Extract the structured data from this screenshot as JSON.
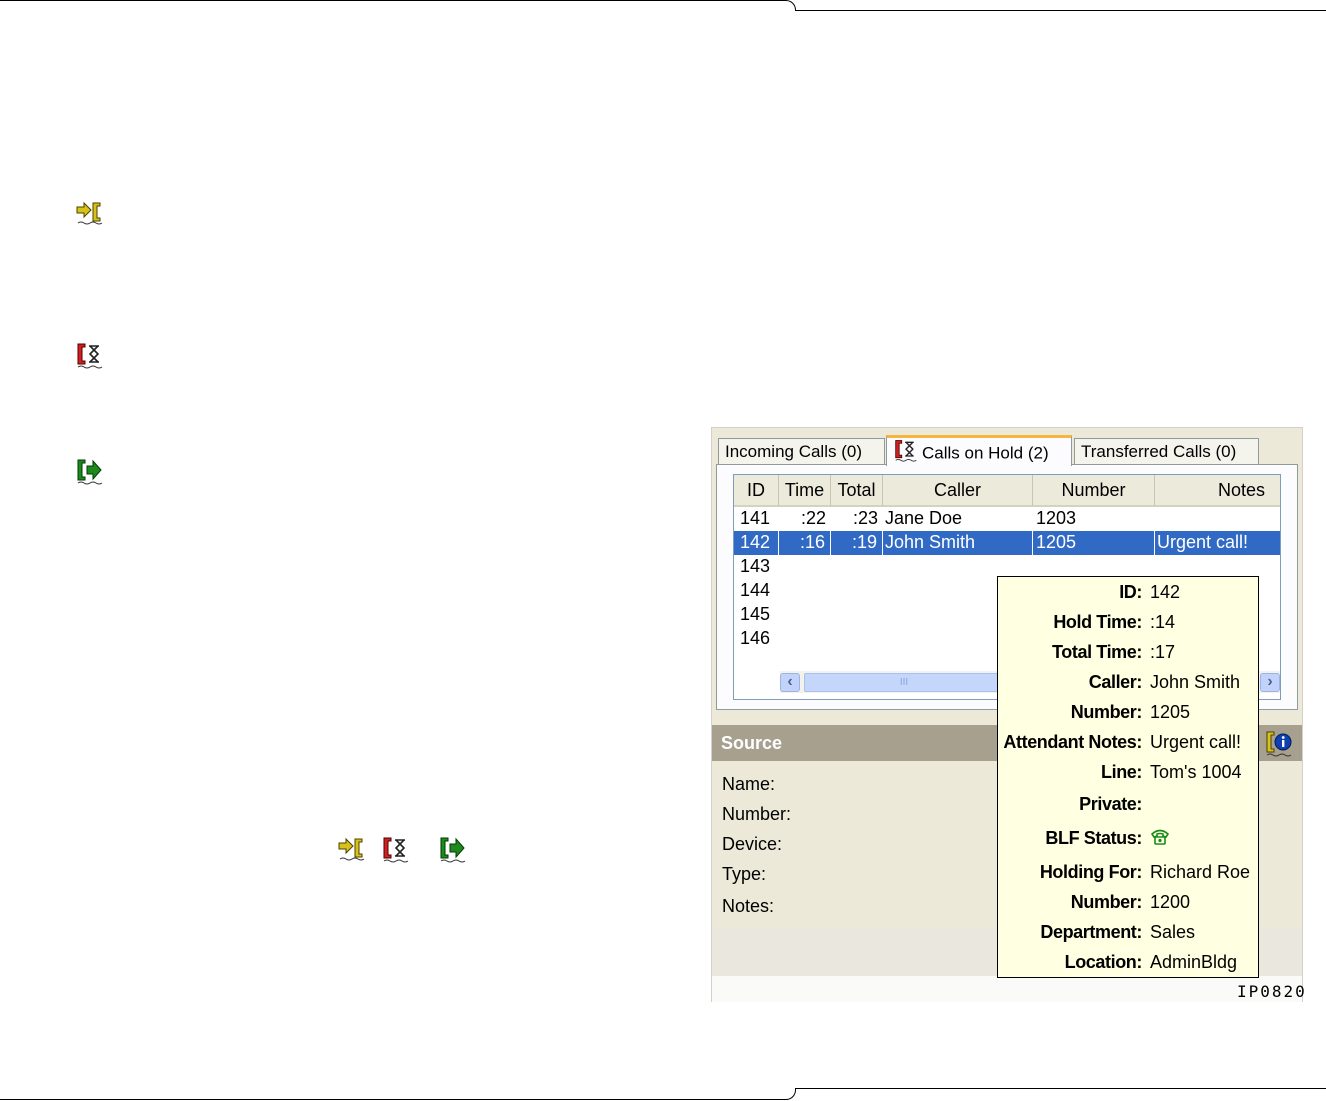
{
  "colors": {
    "selection": "#316ac5",
    "tooltip_bg": "#ffffe1",
    "source_header_bg": "#a7a08f",
    "active_tab_accent": "#f6b53f"
  },
  "legend_icons": [
    "incoming-call-icon",
    "call-on-hold-icon",
    "transferred-call-icon"
  ],
  "tabs": [
    {
      "label": "Incoming Calls (0)",
      "icon": null
    },
    {
      "label": "Calls on Hold (2)",
      "icon": "call-on-hold-icon",
      "active": true
    },
    {
      "label": "Transferred Calls (0)",
      "icon": null
    }
  ],
  "grid": {
    "columns": [
      "ID",
      "Time",
      "Total",
      "Caller",
      "Number",
      "Notes"
    ],
    "rows": [
      {
        "id": "141",
        "time": ":22",
        "total": ":23",
        "caller": "Jane Doe",
        "number": "1203",
        "notes": ""
      },
      {
        "id": "142",
        "time": ":16",
        "total": ":19",
        "caller": "John Smith",
        "number": "1205",
        "notes": "Urgent call!",
        "selected": true
      },
      {
        "id": "143",
        "time": "",
        "total": "",
        "caller": "",
        "number": "",
        "notes": ""
      },
      {
        "id": "144",
        "time": "",
        "total": "",
        "caller": "",
        "number": "",
        "notes": ""
      },
      {
        "id": "145",
        "time": "",
        "total": "",
        "caller": "",
        "number": "",
        "notes": ""
      },
      {
        "id": "146",
        "time": "",
        "total": "",
        "caller": "",
        "number": "",
        "notes": ""
      }
    ],
    "scroll_grip": "III"
  },
  "source": {
    "title": "Source",
    "fields": [
      "Name:",
      "Number:",
      "Device:",
      "Type:",
      "Notes:"
    ]
  },
  "tooltip": {
    "rows": [
      {
        "key": "ID:",
        "value": "142"
      },
      {
        "key": "Hold Time:",
        "value": ":14"
      },
      {
        "key": "Total Time:",
        "value": ":17"
      },
      {
        "key": "Caller:",
        "value": "John Smith"
      },
      {
        "key": "Number:",
        "value": "1205"
      },
      {
        "key": "Attendant Notes:",
        "value": "Urgent call!"
      },
      {
        "key": "Line:",
        "value": "Tom's 1004"
      },
      {
        "key": "Private:",
        "value": ""
      },
      {
        "key": "BLF Status:",
        "value": ""
      },
      {
        "key": "Holding For:",
        "value": "Richard Roe"
      },
      {
        "key": "Number:",
        "value": "1200"
      },
      {
        "key": "Department:",
        "value": "Sales"
      },
      {
        "key": "Location:",
        "value": "AdminBldg"
      }
    ],
    "blf_icon": "phone-idle-icon"
  },
  "figure_ref": "IP0820"
}
